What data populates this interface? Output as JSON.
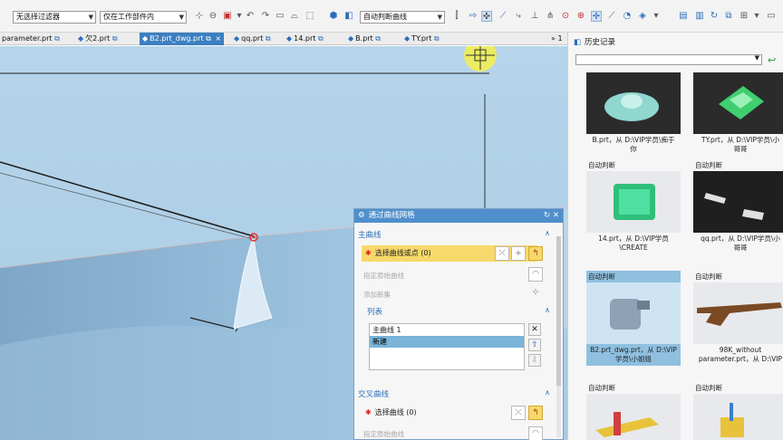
{
  "toolbar": {
    "filter_select": "无选择过滤器",
    "scope_select": "仅在工作部件内",
    "curve_rule_select": "自动判断曲线"
  },
  "tabs": [
    {
      "label": "parameter.prt"
    },
    {
      "label": "欠2.prt"
    },
    {
      "label": "B2.prt_dwg.prt"
    },
    {
      "label": "qq.prt"
    },
    {
      "label": "14.prt"
    },
    {
      "label": "B.prt"
    },
    {
      "label": "TY.prt"
    }
  ],
  "tabs_overflow": "» 1",
  "dialog": {
    "title": "通过曲线网格",
    "primary": {
      "header": "主曲线",
      "select_label": "选择曲线或点 (0)",
      "origin_curve": "指定原始曲线",
      "add_set": "添加新集"
    },
    "list": {
      "header": "列表",
      "items": [
        "主曲线 1",
        "新建"
      ]
    },
    "cross": {
      "header": "交叉曲线",
      "select_label": "选择曲线 (0)",
      "origin_curve": "指定原始曲线"
    }
  },
  "history": {
    "title": "历史记录",
    "items": [
      {
        "caption": "B.prt，从 D:\\VIP学员\\痴于\n你",
        "image": "dark"
      },
      {
        "caption": "TY.prt，从 D:\\VIP学员\\小\n哥哥",
        "image": "dark"
      },
      {
        "header": "自动判断",
        "caption": "14.prt，从 D:\\VIP学员\n\\CREATE",
        "image": "light"
      },
      {
        "header": "自动判断",
        "caption": "qq.prt，从 D:\\VIP学员\\小\n哥哥",
        "image": "light"
      },
      {
        "header": "自动判断",
        "caption": "B2.prt_dwg.prt，从 D:\\VIP\n学员\\小姐姐",
        "image": "selected"
      },
      {
        "header": "自动判断",
        "caption": "98K_without\nparameter.prt，从 D:\\VIP",
        "image": "tan"
      },
      {
        "header": "自动判断",
        "image": "light"
      },
      {
        "header": "自动判断",
        "image": "light"
      }
    ]
  },
  "colors": {
    "accent": "#4f8fcc",
    "highlight": "#f6d96a",
    "viewport": "#b0d0e8"
  }
}
